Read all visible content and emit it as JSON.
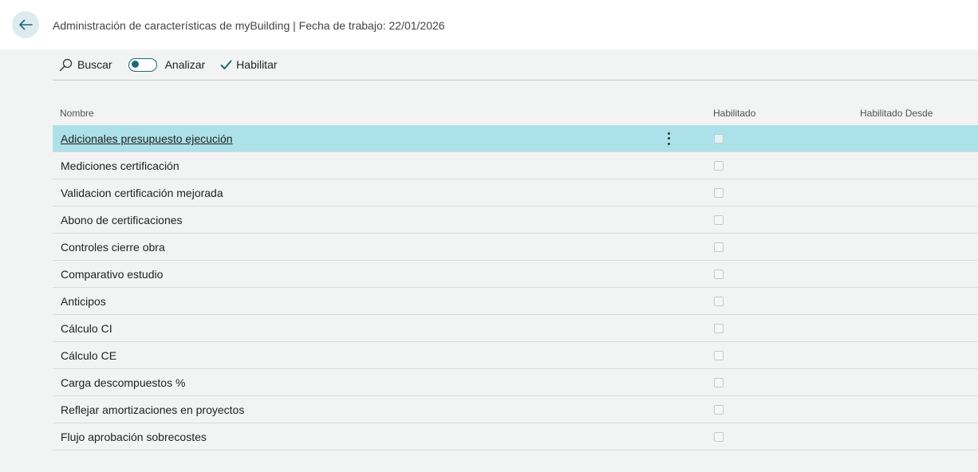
{
  "header": {
    "title": "Administración de características de myBuilding | Fecha de trabajo: 22/01/2026",
    "back_icon": "arrow-left-icon"
  },
  "toolbar": {
    "search_label": "Buscar",
    "analyze_label": "Analizar",
    "analyze_toggle_on": false,
    "enable_label": "Habilitar"
  },
  "columns": {
    "name": "Nombre",
    "enabled": "Habilitado",
    "enabled_from": "Habilitado Desde"
  },
  "rows": [
    {
      "name": "Adicionales presupuesto ejecución",
      "enabled": false,
      "enabled_from": ""
    },
    {
      "name": "Mediciones certificación",
      "enabled": false,
      "enabled_from": ""
    },
    {
      "name": "Validacion certificación mejorada",
      "enabled": false,
      "enabled_from": ""
    },
    {
      "name": "Abono de certificaciones",
      "enabled": false,
      "enabled_from": ""
    },
    {
      "name": "Controles cierre obra",
      "enabled": false,
      "enabled_from": ""
    },
    {
      "name": "Comparativo estudio",
      "enabled": false,
      "enabled_from": ""
    },
    {
      "name": "Anticipos",
      "enabled": false,
      "enabled_from": ""
    },
    {
      "name": "Cálculo CI",
      "enabled": false,
      "enabled_from": ""
    },
    {
      "name": "Cálculo CE",
      "enabled": false,
      "enabled_from": ""
    },
    {
      "name": "Carga descompuestos %",
      "enabled": false,
      "enabled_from": ""
    },
    {
      "name": "Reflejar amortizaciones en proyectos",
      "enabled": false,
      "enabled_from": ""
    },
    {
      "name": "Flujo aprobación sobrecostes",
      "enabled": false,
      "enabled_from": ""
    }
  ],
  "selected_row": 0,
  "colors": {
    "accent": "#1c6b74",
    "selected_row": "#ade1e9",
    "back_button_bg": "#dcebee"
  }
}
